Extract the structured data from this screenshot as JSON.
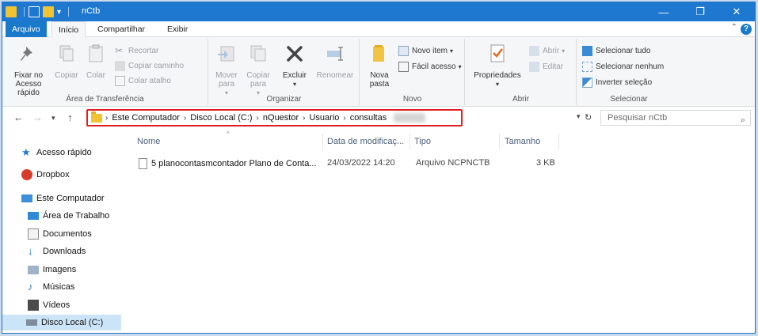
{
  "window": {
    "title": "nCtb"
  },
  "ribbon_tabs": {
    "file": "Arquivo",
    "home": "Início",
    "share": "Compartilhar",
    "view": "Exibir"
  },
  "clipboard": {
    "pin": "Fixar no Acesso rápido",
    "copy": "Copiar",
    "paste": "Colar",
    "cut": "Recortar",
    "copy_path": "Copiar caminho",
    "paste_shortcut": "Colar atalho",
    "label": "Área de Transferência"
  },
  "organize": {
    "move_to": "Mover para",
    "copy_to": "Copiar para",
    "delete": "Excluir",
    "rename": "Renomear",
    "label": "Organizar"
  },
  "new": {
    "new_folder": "Nova pasta",
    "new_item": "Novo item",
    "easy_access": "Fácil acesso",
    "label": "Novo"
  },
  "open": {
    "properties": "Propriedades",
    "open": "Abrir",
    "edit": "Editar",
    "label": "Abrir"
  },
  "select": {
    "select_all": "Selecionar tudo",
    "select_none": "Selecionar nenhum",
    "invert": "Inverter seleção",
    "label": "Selecionar"
  },
  "address": {
    "crumbs": [
      "Este Computador",
      "Disco Local (C:)",
      "nQuestor",
      "Usuario",
      "consultas"
    ],
    "search_placeholder": "Pesquisar nCtb"
  },
  "navpane": {
    "quick_access": "Acesso rápido",
    "dropbox": "Dropbox",
    "this_pc": "Este Computador",
    "desktop": "Área de Trabalho",
    "documents": "Documentos",
    "downloads": "Downloads",
    "pictures": "Imagens",
    "music": "Músicas",
    "videos": "Vídeos",
    "local_disk": "Disco Local (C:)"
  },
  "columns": {
    "name": "Nome",
    "modified": "Data de modificaç...",
    "type": "Tipo",
    "size": "Tamanho"
  },
  "files": [
    {
      "name": "5 planocontasmcontador Plano de Conta...",
      "modified": "24/03/2022 14:20",
      "type": "Arquivo NCPNCTB",
      "size": "3 KB"
    }
  ],
  "colors": {
    "title_bar": "#1e78d0",
    "highlight_border": "#e02020",
    "selection": "#cce4f7"
  }
}
